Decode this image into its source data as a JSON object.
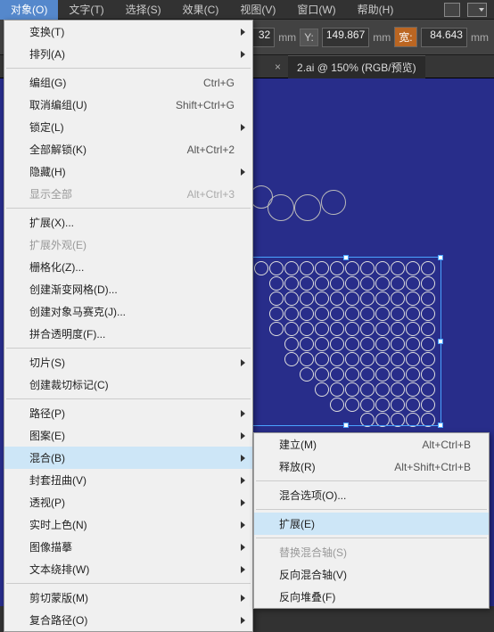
{
  "menubar": {
    "items": [
      {
        "label": "对象(O)",
        "active": true
      },
      {
        "label": "文字(T)"
      },
      {
        "label": "选择(S)"
      },
      {
        "label": "效果(C)"
      },
      {
        "label": "视图(V)"
      },
      {
        "label": "窗口(W)"
      },
      {
        "label": "帮助(H)"
      }
    ]
  },
  "toolbar": {
    "x_value": "32",
    "y_label": "Y:",
    "y_value": "149.867",
    "w_label": "宽:",
    "w_value": "84.643",
    "unit": "mm"
  },
  "tab": {
    "close": "×",
    "label": "2.ai @ 150% (RGB/预览)"
  },
  "menu": {
    "groups": [
      [
        {
          "label": "变换(T)",
          "sub": true
        },
        {
          "label": "排列(A)",
          "sub": true
        }
      ],
      [
        {
          "label": "编组(G)",
          "shortcut": "Ctrl+G"
        },
        {
          "label": "取消编组(U)",
          "shortcut": "Shift+Ctrl+G"
        },
        {
          "label": "锁定(L)",
          "sub": true
        },
        {
          "label": "全部解锁(K)",
          "shortcut": "Alt+Ctrl+2"
        },
        {
          "label": "隐藏(H)",
          "sub": true
        },
        {
          "label": "显示全部",
          "shortcut": "Alt+Ctrl+3",
          "disabled": true
        }
      ],
      [
        {
          "label": "扩展(X)..."
        },
        {
          "label": "扩展外观(E)",
          "disabled": true
        },
        {
          "label": "栅格化(Z)..."
        },
        {
          "label": "创建渐变网格(D)..."
        },
        {
          "label": "创建对象马赛克(J)..."
        },
        {
          "label": "拼合透明度(F)..."
        }
      ],
      [
        {
          "label": "切片(S)",
          "sub": true
        },
        {
          "label": "创建裁切标记(C)"
        }
      ],
      [
        {
          "label": "路径(P)",
          "sub": true
        },
        {
          "label": "图案(E)",
          "sub": true
        },
        {
          "label": "混合(B)",
          "sub": true,
          "highlight": true
        },
        {
          "label": "封套扭曲(V)",
          "sub": true
        },
        {
          "label": "透视(P)",
          "sub": true
        },
        {
          "label": "实时上色(N)",
          "sub": true
        },
        {
          "label": "图像描摹",
          "sub": true
        },
        {
          "label": "文本绕排(W)",
          "sub": true
        }
      ],
      [
        {
          "label": "剪切蒙版(M)",
          "sub": true
        },
        {
          "label": "复合路径(O)",
          "sub": true
        }
      ]
    ]
  },
  "submenu": {
    "groups": [
      [
        {
          "label": "建立(M)",
          "shortcut": "Alt+Ctrl+B"
        },
        {
          "label": "释放(R)",
          "shortcut": "Alt+Shift+Ctrl+B"
        }
      ],
      [
        {
          "label": "混合选项(O)..."
        }
      ],
      [
        {
          "label": "扩展(E)",
          "highlight": true
        }
      ],
      [
        {
          "label": "替换混合轴(S)",
          "disabled": true
        },
        {
          "label": "反向混合轴(V)"
        },
        {
          "label": "反向堆叠(F)"
        }
      ]
    ]
  }
}
